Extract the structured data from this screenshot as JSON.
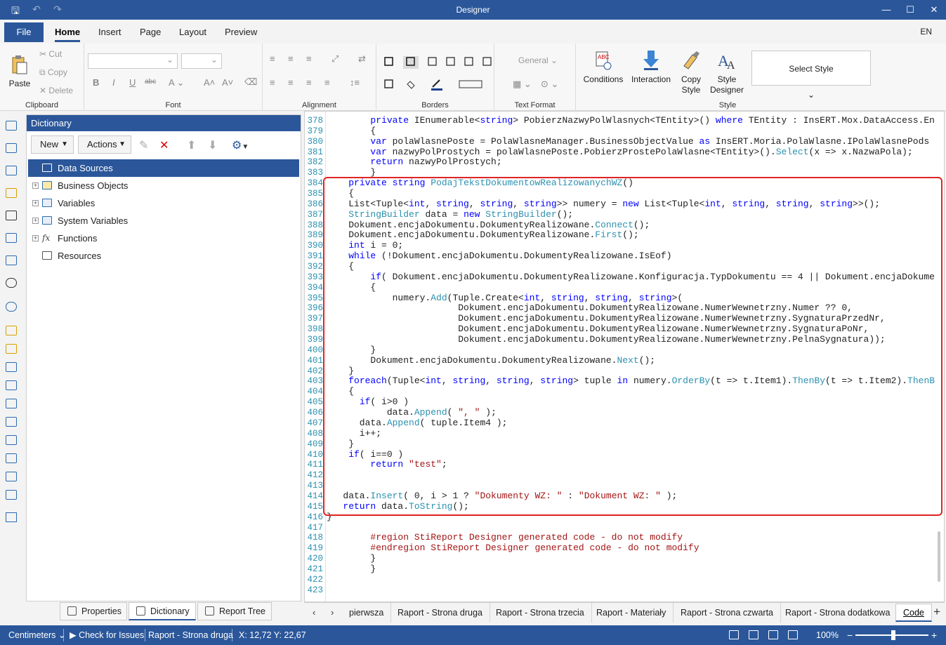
{
  "window": {
    "title": "Designer",
    "controls": [
      "—",
      "☐",
      "✕"
    ]
  },
  "ribbon_tabs": {
    "file": "File",
    "tabs": [
      "Home",
      "Insert",
      "Page",
      "Layout",
      "Preview"
    ],
    "lang": "EN"
  },
  "ribbon": {
    "clipboard": {
      "paste": "Paste",
      "cut": "Cut",
      "copy": "Copy",
      "delete": "Delete",
      "label": "Clipboard"
    },
    "font": {
      "label": "Font"
    },
    "alignment": {
      "label": "Alignment"
    },
    "borders": {
      "label": "Borders"
    },
    "text_format": {
      "general": "General",
      "label": "Text Format"
    },
    "style": {
      "conditions": "Conditions",
      "interaction": "Interaction",
      "copy_style_1": "Copy",
      "copy_style_2": "Style",
      "style_designer_1": "Style",
      "style_designer_2": "Designer",
      "select_style": "Select Style",
      "label": "Style"
    }
  },
  "dictionary": {
    "title": "Dictionary",
    "new_label": "New",
    "actions_label": "Actions",
    "tree": [
      {
        "label": "Data Sources",
        "expandable": false,
        "selected": true
      },
      {
        "label": "Business Objects",
        "expandable": true
      },
      {
        "label": "Variables",
        "expandable": true
      },
      {
        "label": "System Variables",
        "expandable": true
      },
      {
        "label": "Functions",
        "expandable": true
      },
      {
        "label": "Resources",
        "expandable": false
      }
    ]
  },
  "panel_tabs": [
    "Properties",
    "Dictionary",
    "Report Tree"
  ],
  "code": {
    "lines": [
      {
        "n": "378",
        "t": "        private IEnumerable<string> PobierzNazwyPolWlasnych<TEntity>() where TEntity : InsERT.Mox.DataAccess.En"
      },
      {
        "n": "379",
        "t": "        {"
      },
      {
        "n": "380",
        "t": "        var polaWlasnePoste = PolaWlasneManager.BusinessObjectValue as InsERT.Moria.PolaWlasne.IPolaWlasnePods"
      },
      {
        "n": "381",
        "t": "        var nazwyPolProstych = polaWlasnePoste.PobierzProstePolaWlasne<TEntity>().Select(x => x.NazwaPola);"
      },
      {
        "n": "382",
        "t": "        return nazwyPolProstych;"
      },
      {
        "n": "383",
        "t": "        }"
      },
      {
        "n": "384",
        "t": "    private string PodajTekstDokumentowRealizowanychWZ()"
      },
      {
        "n": "385",
        "t": "    {"
      },
      {
        "n": "386",
        "t": "    List<Tuple<int, string, string, string>> numery = new List<Tuple<int, string, string, string>>();"
      },
      {
        "n": "387",
        "t": "    StringBuilder data = new StringBuilder();"
      },
      {
        "n": "388",
        "t": "    Dokument.encjaDokumentu.DokumentyRealizowane.Connect();"
      },
      {
        "n": "389",
        "t": "    Dokument.encjaDokumentu.DokumentyRealizowane.First();"
      },
      {
        "n": "390",
        "t": "    int i = 0;"
      },
      {
        "n": "391",
        "t": "    while (!Dokument.encjaDokumentu.DokumentyRealizowane.IsEof)"
      },
      {
        "n": "392",
        "t": "    {"
      },
      {
        "n": "393",
        "t": "        if( Dokument.encjaDokumentu.DokumentyRealizowane.Konfiguracja.TypDokumentu == 4 || Dokument.encjaDokume"
      },
      {
        "n": "394",
        "t": "        {"
      },
      {
        "n": "395",
        "t": "            numery.Add(Tuple.Create<int, string, string, string>("
      },
      {
        "n": "396",
        "t": "                        Dokument.encjaDokumentu.DokumentyRealizowane.NumerWewnetrzny.Numer ?? 0,"
      },
      {
        "n": "397",
        "t": "                        Dokument.encjaDokumentu.DokumentyRealizowane.NumerWewnetrzny.SygnaturaPrzedNr,"
      },
      {
        "n": "398",
        "t": "                        Dokument.encjaDokumentu.DokumentyRealizowane.NumerWewnetrzny.SygnaturaPoNr,"
      },
      {
        "n": "399",
        "t": "                        Dokument.encjaDokumentu.DokumentyRealizowane.NumerWewnetrzny.PelnaSygnatura));"
      },
      {
        "n": "400",
        "t": "        }"
      },
      {
        "n": "401",
        "t": "        Dokument.encjaDokumentu.DokumentyRealizowane.Next();"
      },
      {
        "n": "402",
        "t": "    }"
      },
      {
        "n": "403",
        "t": "    foreach(Tuple<int, string, string, string> tuple in numery.OrderBy(t => t.Item1).ThenBy(t => t.Item2).ThenB"
      },
      {
        "n": "404",
        "t": "    {"
      },
      {
        "n": "405",
        "t": "      if( i>0 )"
      },
      {
        "n": "406",
        "t": "           data.Append( \", \" );"
      },
      {
        "n": "407",
        "t": "      data.Append( tuple.Item4 );"
      },
      {
        "n": "408",
        "t": "      i++;"
      },
      {
        "n": "409",
        "t": "    }"
      },
      {
        "n": "410",
        "t": "    if( i==0 )"
      },
      {
        "n": "411",
        "t": "        return \"test\";"
      },
      {
        "n": "412",
        "t": ""
      },
      {
        "n": "413",
        "t": ""
      },
      {
        "n": "414",
        "t": "   data.Insert( 0, i > 1 ? \"Dokumenty WZ: \" : \"Dokument WZ: \" );"
      },
      {
        "n": "415",
        "t": "   return data.ToString();"
      },
      {
        "n": "416",
        "t": "}"
      },
      {
        "n": "417",
        "t": ""
      },
      {
        "n": "418",
        "t": "        #region StiReport Designer generated code - do not modify"
      },
      {
        "n": "419",
        "t": "        #endregion StiReport Designer generated code - do not modify"
      },
      {
        "n": "420",
        "t": "        }"
      },
      {
        "n": "421",
        "t": "        }"
      },
      {
        "n": "422",
        "t": ""
      },
      {
        "n": "423",
        "t": ""
      }
    ]
  },
  "report_tabs": [
    "pierwsza",
    "Raport - Strona druga",
    "Raport - Strona trzecia",
    "Raport - Materiały",
    "Raport - Strona czwarta",
    "Raport - Strona dodatkowa",
    "Code"
  ],
  "status": {
    "units": "Centimeters",
    "check": "Check for Issues",
    "page": "Raport - Strona druga",
    "coords": "X: 12,72 Y: 22,67",
    "zoom": "100%"
  },
  "colors": {
    "accent": "#2b579a",
    "highlight_box": "#e02424"
  }
}
